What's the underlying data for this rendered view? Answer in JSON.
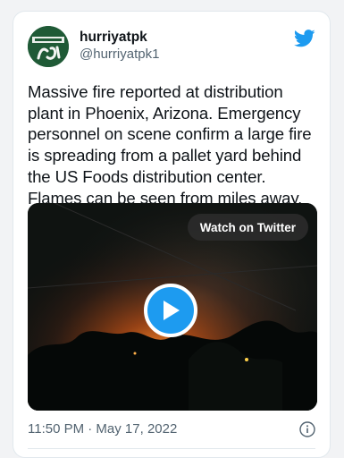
{
  "tweet": {
    "author": {
      "display_name": "hurriyatpk",
      "handle": "@hurriyatpk1",
      "avatar_icon": "hurriyat-logo-icon"
    },
    "text": "Massive fire reported at distribution plant in Phoenix, Arizona. Emergency personnel on scene confirm a large fire is spreading from a pallet yard behind the US Foods distribution center. Flames can be seen from miles away.",
    "media": {
      "watch_label": "Watch on Twitter",
      "play_icon": "play-icon"
    },
    "timestamp": "11:50 PM · May 17, 2022",
    "info_icon": "info-icon",
    "brand_icon": "twitter-bird-icon"
  },
  "colors": {
    "twitter_blue": "#1d9bf0",
    "text_primary": "#0f1419",
    "text_secondary": "#536471",
    "avatar_green": "#1f5a36"
  }
}
